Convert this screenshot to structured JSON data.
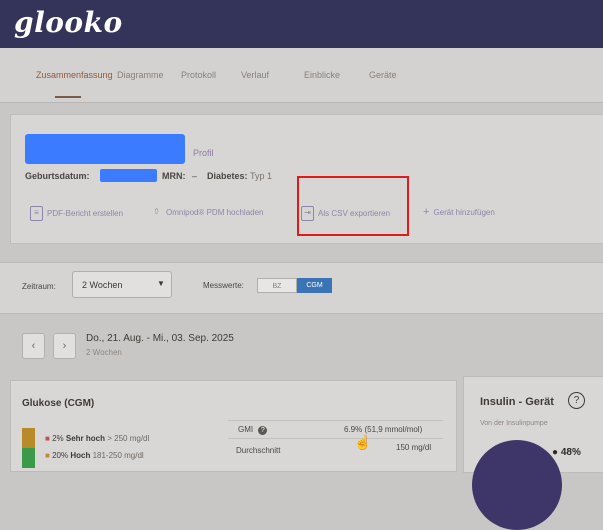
{
  "brand": {
    "logo_text": "glooko"
  },
  "tabs": [
    {
      "label": "Zusammenfassung",
      "active": true
    },
    {
      "label": "Diagramme",
      "active": false
    },
    {
      "label": "Protokoll",
      "active": false
    },
    {
      "label": "Verlauf",
      "active": false
    },
    {
      "label": "Einblicke",
      "active": false
    },
    {
      "label": "Geräte",
      "active": false
    }
  ],
  "patient": {
    "profile_link": "Profil",
    "birthdate_label": "Geburtsdatum:",
    "mrn_label": "MRN:",
    "mrn_value": "–",
    "diabetes_label": "Diabetes:",
    "diabetes_value": "Typ 1"
  },
  "actions": [
    {
      "label": "PDF-Bericht erstellen",
      "icon": "file-icon"
    },
    {
      "label": "Omnipod® PDM hochladen",
      "icon": "upload-icon"
    },
    {
      "label": "Als CSV exportieren",
      "icon": "export-icon"
    },
    {
      "label": "Gerät hinzufügen",
      "icon": "plus-icon"
    }
  ],
  "filters": {
    "range_label": "Zeitraum:",
    "range_value": "2 Wochen",
    "measure_label": "Messwerte:",
    "measure_options": [
      "BZ",
      "CGM"
    ],
    "measure_selected": "CGM"
  },
  "date_nav": {
    "range_text": "Do., 21. Aug. - Mi., 03. Sep. 2025",
    "sub_text": "2 Wochen"
  },
  "glucose": {
    "title": "Glukose (CGM)",
    "rows": [
      {
        "pct": "2%",
        "label": "Sehr hoch",
        "range": "> 250 mg/dl",
        "color": "#b88a2a"
      },
      {
        "pct": "20%",
        "label": "Hoch",
        "range": "181-250 mg/dl",
        "color": "#3a9a4a"
      }
    ],
    "gmi_label": "GMI",
    "gmi_value": "6.9% (51,9 mmol/mol)",
    "avg_label": "Durchschnitt",
    "avg_value": "150 mg/dl"
  },
  "insulin": {
    "title": "Insulin - Gerät",
    "help_icon": "question-icon",
    "subtitle": "Von der Insulinpumpe",
    "pct": "48%"
  },
  "colors": {
    "brand_bar": "#34345a",
    "accent_blue": "#3a7bff",
    "highlight_red": "#e11b1b"
  }
}
